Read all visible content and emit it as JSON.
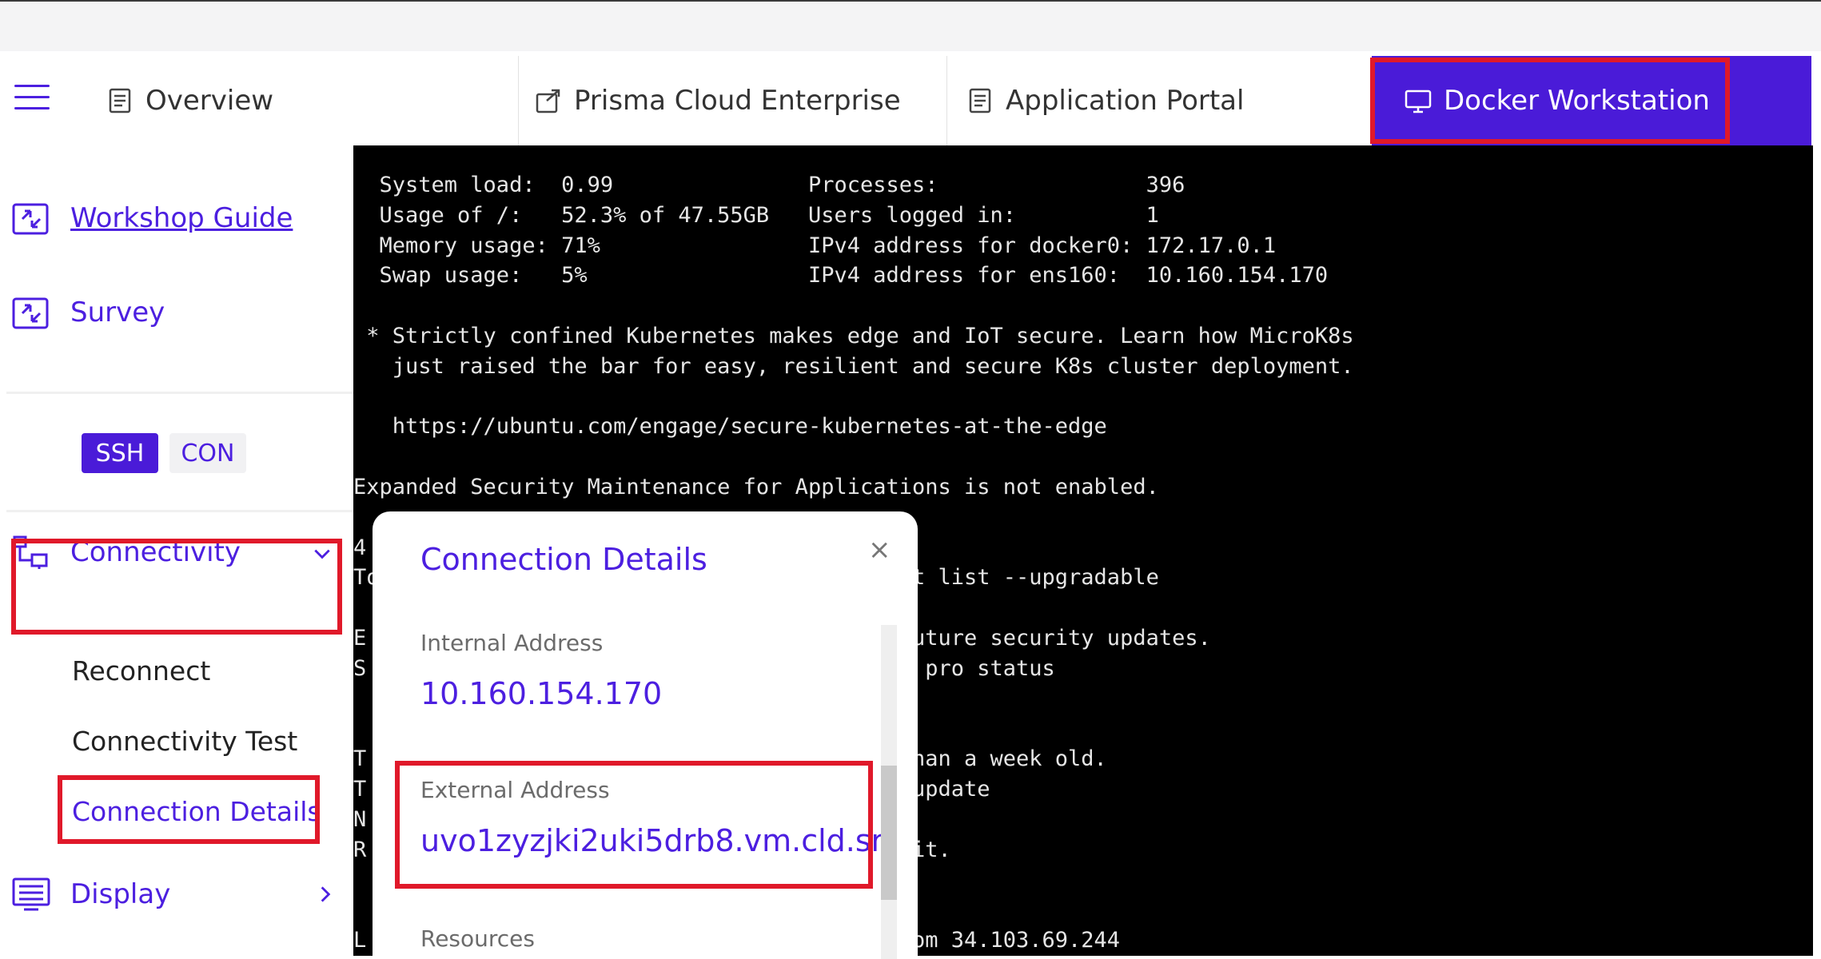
{
  "tabs": [
    {
      "label": "Overview",
      "icon": "document-icon"
    },
    {
      "label": "Prisma Cloud Enterprise",
      "icon": "external-link-icon"
    },
    {
      "label": "Application Portal",
      "icon": "document-icon"
    },
    {
      "label": "Docker Workstation",
      "icon": "monitor-icon",
      "active": true
    }
  ],
  "sidebar": {
    "workshop_guide": "Workshop Guide",
    "survey": "Survey",
    "ssh_label": "SSH",
    "con_label": "CON",
    "connectivity": "Connectivity",
    "reconnect": "Reconnect",
    "connectivity_test": "Connectivity Test",
    "connection_details": "Connection Details",
    "display": "Display"
  },
  "terminal": {
    "lines": [
      "  System load:  0.99               Processes:                396",
      "  Usage of /:   52.3% of 47.55GB   Users logged in:          1",
      "  Memory usage: 71%                IPv4 address for docker0: 172.17.0.1",
      "  Swap usage:   5%                 IPv4 address for ens160:  10.160.154.170",
      "",
      " * Strictly confined Kubernetes makes edge and IoT secure. Learn how MicroK8s",
      "   just raised the bar for easy, resilient and secure K8s cluster deployment.",
      "",
      "   https://ubuntu.com/engage/secure-kubernetes-at-the-edge",
      "",
      "Expanded Security Maintenance for Applications is not enabled.",
      "",
      "4",
      "To                                        pt list --upgradable",
      "",
      "E                                         future security updates.",
      "S                                         o pro status",
      "",
      "",
      "T                                         than a week old.",
      "T                                          update",
      "N",
      "R                                          it.",
      "",
      "",
      "L                                         rom 34.103.69.244"
    ]
  },
  "modal": {
    "title": "Connection Details",
    "close": "×",
    "internal_label": "Internal Address",
    "internal_value": "10.160.154.170",
    "external_label": "External Address",
    "external_value": "uvo1zyzjki2uki5drb8.vm.cld.sr",
    "resources_label": "Resources"
  },
  "colors": {
    "accent": "#4c1fe0",
    "active_tab": "#4a1bd8",
    "highlight": "#e0192a",
    "terminal_bg": "#000000"
  }
}
